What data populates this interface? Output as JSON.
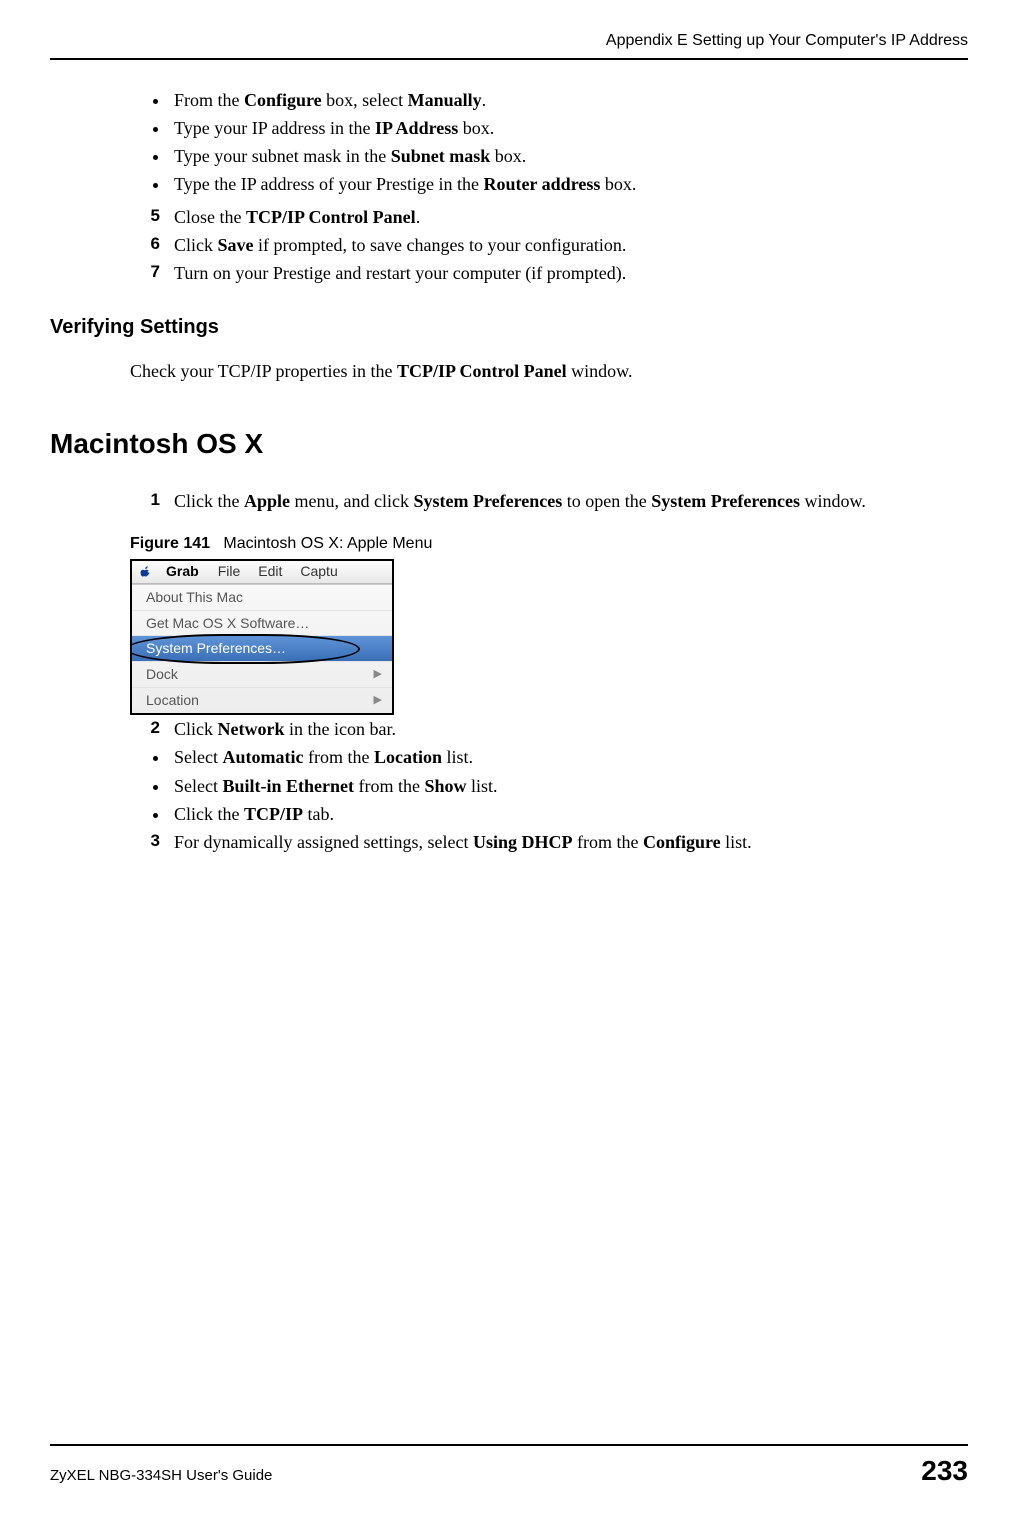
{
  "header": {
    "title": "Appendix E Setting up Your Computer's IP Address"
  },
  "top_bullets": [
    {
      "pre": "From the ",
      "b1": "Configure",
      "mid1": " box, select ",
      "b2": "Manually",
      "post": "."
    },
    {
      "pre": "Type your IP address in the ",
      "b1": "IP Address",
      "mid1": "",
      "b2": "",
      "post": " box."
    },
    {
      "pre": "Type your subnet mask in the ",
      "b1": "Subnet mask",
      "mid1": "",
      "b2": "",
      "post": " box."
    },
    {
      "pre": "Type the IP address of your Prestige in the ",
      "b1": "Router address",
      "mid1": "",
      "b2": "",
      "post": " box."
    }
  ],
  "steps_a": [
    {
      "num": "5",
      "pre": "Close the ",
      "b1": "TCP/IP Control Panel",
      "post": "."
    },
    {
      "num": "6",
      "pre": "Click ",
      "b1": "Save",
      "post": " if prompted, to save changes to your configuration."
    },
    {
      "num": "7",
      "pre": "Turn on your Prestige and restart your computer (if prompted).",
      "b1": "",
      "post": ""
    }
  ],
  "verify": {
    "heading": "Verifying Settings",
    "text_pre": "Check your TCP/IP properties in the ",
    "text_b": "TCP/IP Control Panel",
    "text_post": " window."
  },
  "osx": {
    "heading": "Macintosh OS X",
    "step1": {
      "num": "1",
      "pre": "Click the ",
      "b1": "Apple",
      "mid1": " menu, and click ",
      "b2": "System Preferences",
      "mid2": " to open the ",
      "b3": "System Preferences",
      "post": " window."
    },
    "figure": {
      "label": "Figure 141",
      "caption": "Macintosh OS X: Apple Menu"
    },
    "menu": {
      "app": "Grab",
      "items": [
        "File",
        "Edit",
        "Captu"
      ],
      "rows": [
        {
          "label": "About This Mac",
          "arrow": false,
          "highlight": false
        },
        {
          "label": "Get Mac OS X Software…",
          "arrow": false,
          "highlight": false
        },
        {
          "label": "System Preferences…",
          "arrow": false,
          "highlight": true
        },
        {
          "label": "Dock",
          "arrow": true,
          "highlight": false
        },
        {
          "label": "Location",
          "arrow": true,
          "highlight": false
        }
      ]
    },
    "step2": {
      "num": "2",
      "pre": "Click ",
      "b1": "Network",
      "post": " in the icon bar."
    },
    "sub_bullets": [
      {
        "pre": "Select ",
        "b1": "Automatic",
        "mid": " from the ",
        "b2": "Location",
        "post": " list."
      },
      {
        "pre": "Select ",
        "b1": "Built-in Ethernet",
        "mid": " from the ",
        "b2": "Show",
        "post": " list."
      },
      {
        "pre": "Click the ",
        "b1": "TCP/IP",
        "mid": "",
        "b2": "",
        "post": " tab."
      }
    ],
    "step3": {
      "num": "3",
      "pre": "For dynamically assigned settings, select ",
      "b1": "Using DHCP",
      "mid": " from the ",
      "b2": "Configure",
      "post": " list."
    }
  },
  "footer": {
    "left": "ZyXEL NBG-334SH User's Guide",
    "right": "233"
  }
}
